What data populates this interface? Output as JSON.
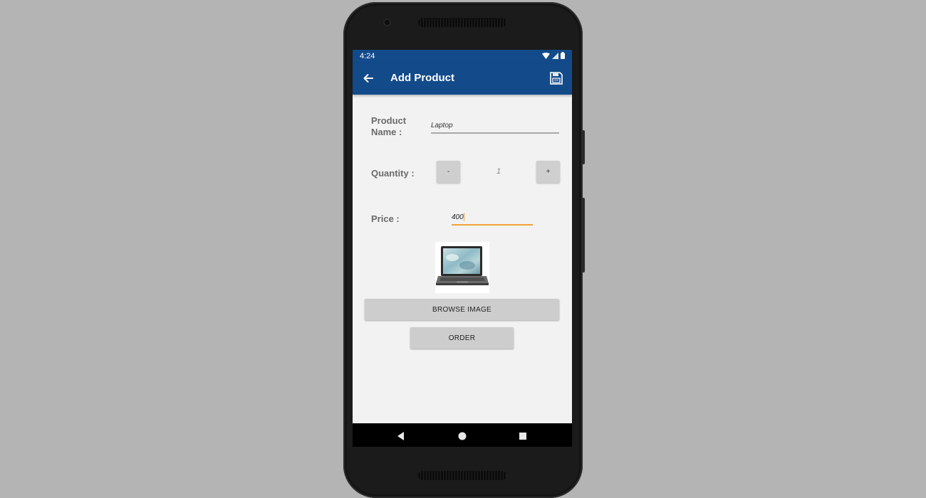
{
  "status_bar": {
    "time": "4:24",
    "icons": [
      "wifi-icon",
      "signal-icon",
      "battery-icon"
    ]
  },
  "app_bar": {
    "title": "Add Product",
    "back_icon": "arrow-left-icon",
    "save_icon": "save-icon",
    "color": "#124a8a"
  },
  "form": {
    "product_name_label": "Product Name :",
    "product_name_value": "Laptop",
    "quantity_label": "Quantity :",
    "decrement_label": "-",
    "quantity_value": "1",
    "increment_label": "+",
    "price_label": "Price :",
    "price_value": "400",
    "accent_color": "#f2a23a"
  },
  "actions": {
    "browse_image_label": "BROWSE IMAGE",
    "order_label": "ORDER"
  },
  "nav_bar": {
    "icons": [
      "back-triangle-icon",
      "home-circle-icon",
      "recents-square-icon"
    ]
  }
}
